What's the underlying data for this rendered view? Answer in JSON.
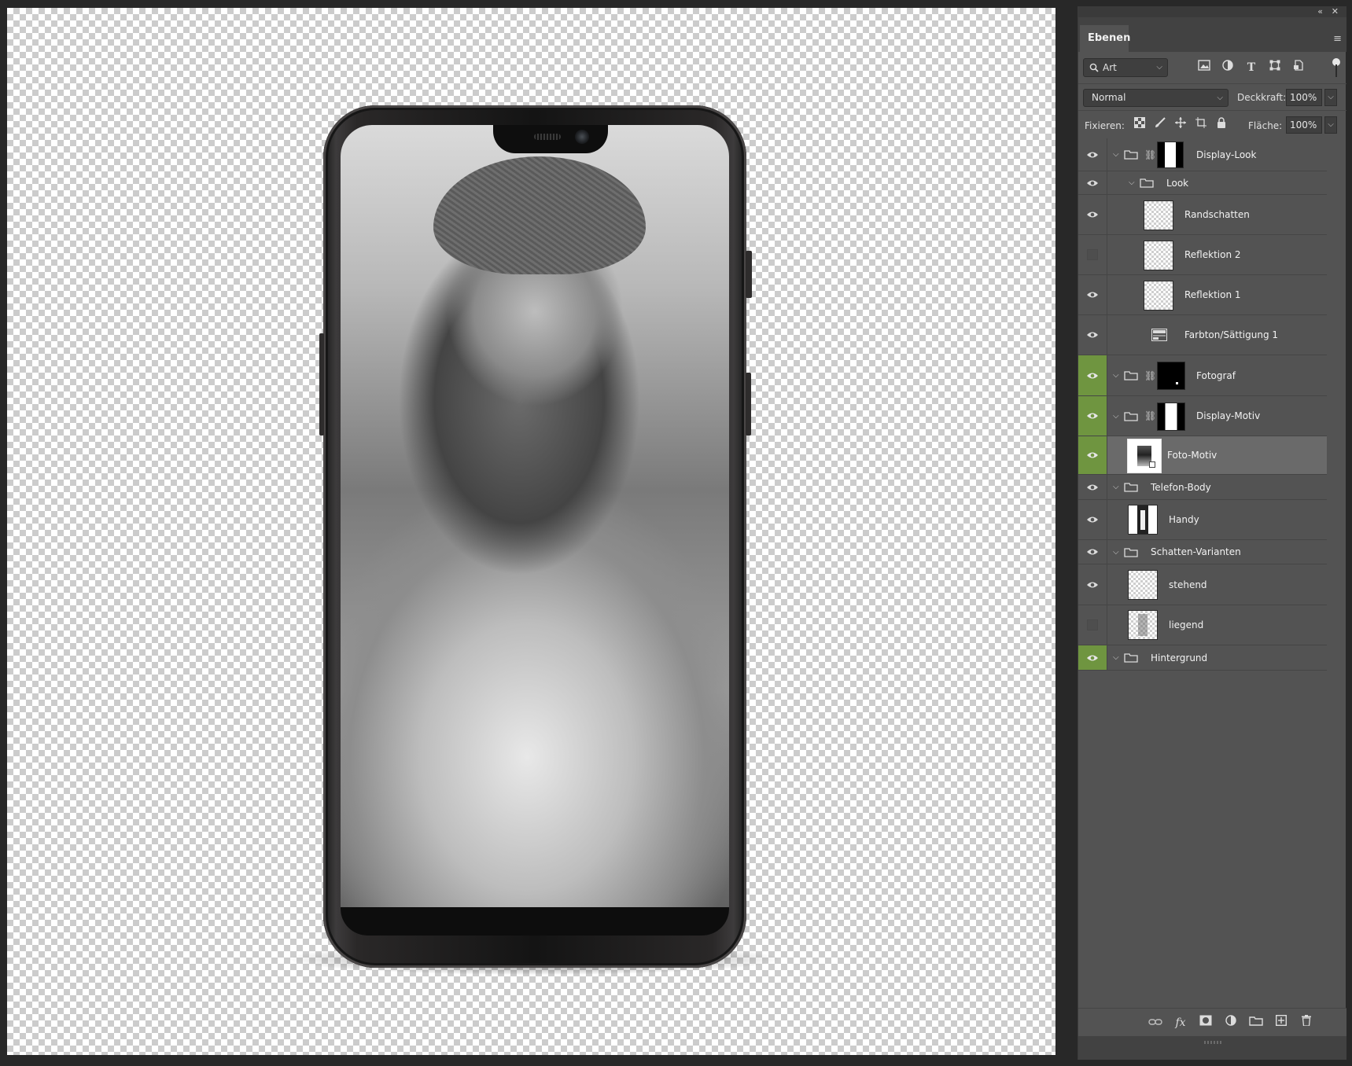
{
  "panel": {
    "tab_label": "Ebenen",
    "filter": {
      "kind_value": "Art"
    },
    "blend_mode": "Normal",
    "opacity_label": "Deckkraft:",
    "opacity_value": "100%",
    "lock_label": "Fixieren:",
    "fill_label": "Fläche:",
    "fill_value": "100%"
  },
  "layers": [
    {
      "name": "Display-Look",
      "visible": true,
      "highlight": false,
      "type": "group-mask",
      "indent": 0,
      "selected": false
    },
    {
      "name": "Look",
      "visible": true,
      "highlight": false,
      "type": "group",
      "indent": 1,
      "selected": false
    },
    {
      "name": "Randschatten",
      "visible": true,
      "highlight": false,
      "type": "pixel",
      "indent": 2,
      "selected": false
    },
    {
      "name": "Reflektion 2",
      "visible": false,
      "highlight": false,
      "type": "pixel",
      "indent": 2,
      "selected": false
    },
    {
      "name": "Reflektion 1",
      "visible": true,
      "highlight": false,
      "type": "pixel",
      "indent": 2,
      "selected": false
    },
    {
      "name": "Farbton/Sättigung 1",
      "visible": true,
      "highlight": false,
      "type": "adjustment",
      "indent": 2,
      "selected": false
    },
    {
      "name": "Fotograf",
      "visible": true,
      "highlight": true,
      "type": "group-mask-black",
      "indent": 0,
      "selected": false
    },
    {
      "name": "Display-Motiv",
      "visible": true,
      "highlight": true,
      "type": "group-mask",
      "indent": 0,
      "selected": false
    },
    {
      "name": "Foto-Motiv",
      "visible": true,
      "highlight": true,
      "type": "smart",
      "indent": 1,
      "selected": true
    },
    {
      "name": "Telefon-Body",
      "visible": true,
      "highlight": false,
      "type": "group",
      "indent": 0,
      "selected": false
    },
    {
      "name": "Handy",
      "visible": true,
      "highlight": false,
      "type": "pixel-phone",
      "indent": 1,
      "selected": false
    },
    {
      "name": "Schatten-Varianten",
      "visible": true,
      "highlight": false,
      "type": "group",
      "indent": 0,
      "selected": false
    },
    {
      "name": "stehend",
      "visible": true,
      "highlight": false,
      "type": "pixel",
      "indent": 1,
      "selected": false
    },
    {
      "name": "liegend",
      "visible": false,
      "highlight": false,
      "type": "pixel",
      "indent": 1,
      "selected": false
    },
    {
      "name": "Hintergrund",
      "visible": true,
      "highlight": true,
      "type": "group",
      "indent": 0,
      "selected": false
    }
  ],
  "colors": {
    "panel_bg": "#535353",
    "eye_highlight": "#6f9540",
    "selected_row": "#6a6a6a"
  }
}
